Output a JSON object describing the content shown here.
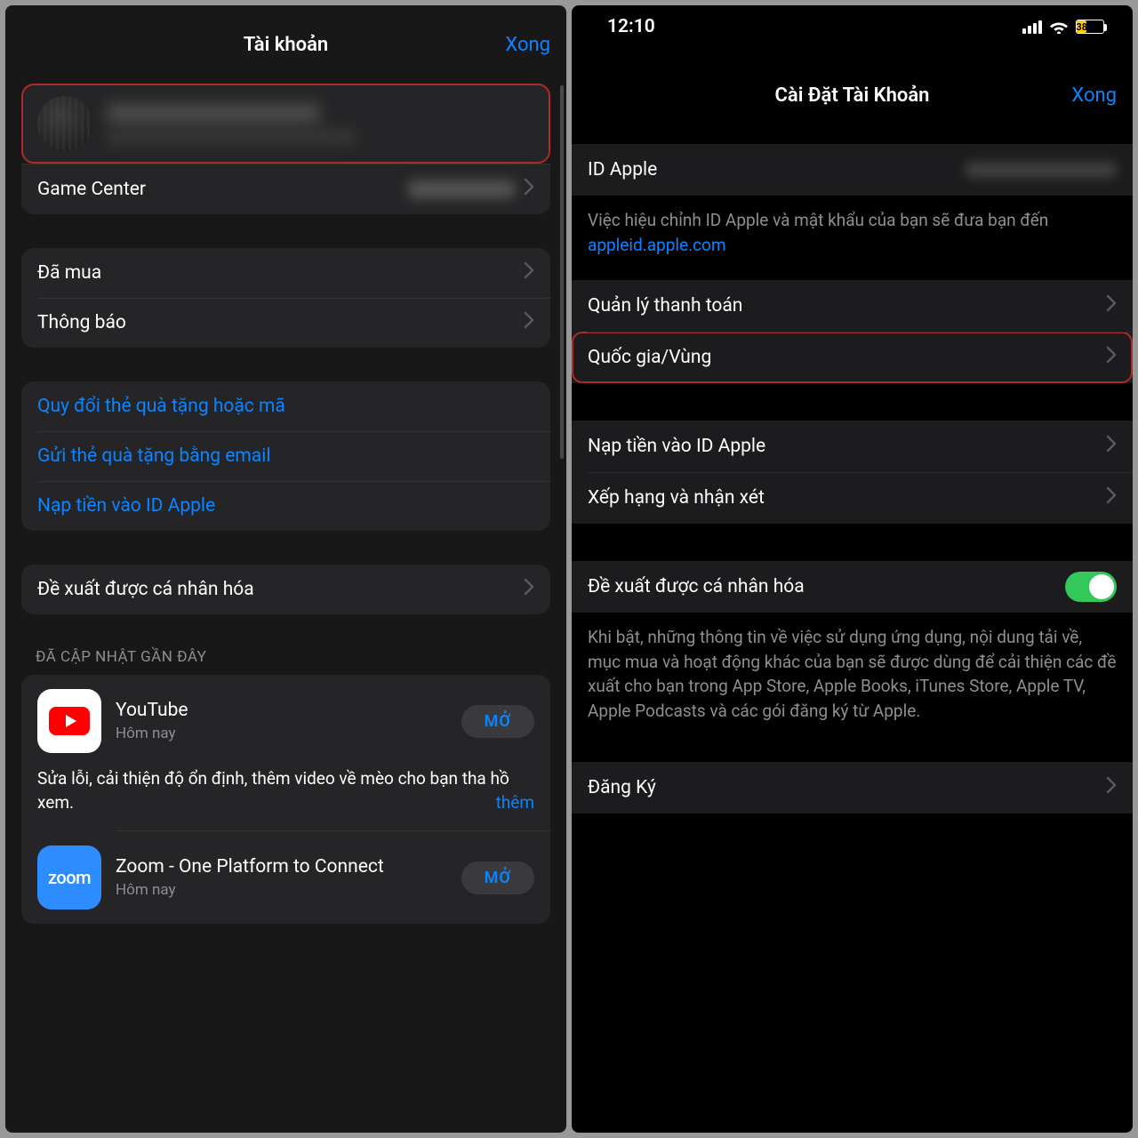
{
  "left": {
    "nav": {
      "title": "Tài khoản",
      "done": "Xong"
    },
    "gamecenter_label": "Game Center",
    "purchased": "Đã mua",
    "notifications": "Thông báo",
    "redeem": "Quy đổi thẻ quà tặng hoặc mã",
    "send_gift": "Gửi thẻ quà tặng bằng email",
    "add_funds": "Nạp tiền vào ID Apple",
    "personalized": "Đề xuất được cá nhân hóa",
    "recent_updates_header": "ĐÃ CẬP NHẬT GẦN ĐÂY",
    "apps": {
      "youtube": {
        "name": "YouTube",
        "sub": "Hôm nay",
        "open": "MỞ",
        "desc": "Sửa lỗi, cải thiện độ ổn định, thêm video về mèo cho bạn tha hồ xem.",
        "more": "thêm"
      },
      "zoom": {
        "name": "Zoom - One Platform to Connect",
        "sub": "Hôm nay",
        "open": "MỞ",
        "logo": "zoom"
      }
    }
  },
  "right": {
    "status_time": "12:10",
    "battery_pct": "38",
    "nav": {
      "title": "Cài Đặt Tài Khoản",
      "done": "Xong"
    },
    "apple_id_label": "ID Apple",
    "apple_id_note_prefix": "Việc hiệu chỉnh ID Apple và mật khẩu của bạn sẽ đưa bạn đến ",
    "apple_id_note_link": "appleid.apple.com",
    "manage_payments": "Quản lý thanh toán",
    "country_region": "Quốc gia/Vùng",
    "add_funds": "Nạp tiền vào ID Apple",
    "ratings_reviews": "Xếp hạng và nhận xét",
    "personalized": "Đề xuất được cá nhân hóa",
    "personalized_note": "Khi bật, những thông tin về việc sử dụng ứng dụng, nội dung tải về, mục mua và hoạt động khác của bạn sẽ được dùng để cải thiện các đề xuất cho bạn trong App Store, Apple Books, iTunes Store, Apple TV, Apple Podcasts và các gói đăng ký từ Apple.",
    "subscriptions": "Đăng Ký"
  },
  "colors": {
    "accent": "#0a84ff",
    "highlight": "#b02a2a",
    "toggle_on": "#34c759",
    "battery": "#ffcc00"
  }
}
